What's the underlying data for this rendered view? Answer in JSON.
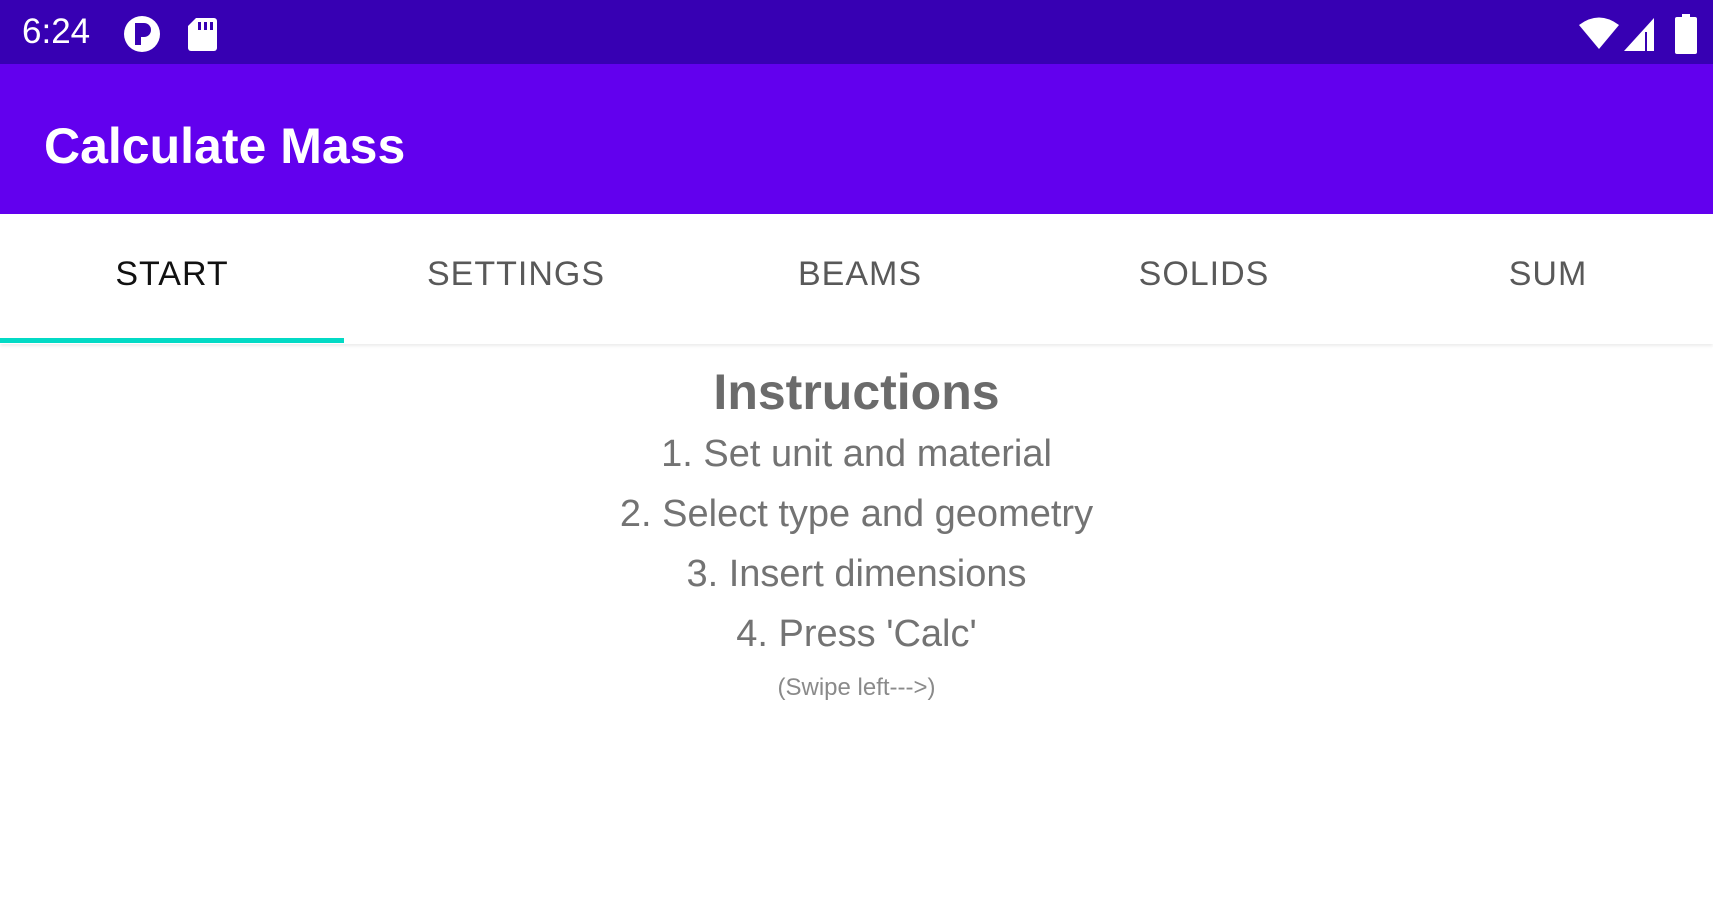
{
  "status_bar": {
    "time": "6:24",
    "left_icons": [
      "p-icon",
      "sd-card-icon"
    ],
    "right_icons": [
      "wifi-icon",
      "signal-icon",
      "battery-icon"
    ]
  },
  "app_bar": {
    "title": "Calculate Mass"
  },
  "tabs": [
    {
      "label": "START",
      "selected": true
    },
    {
      "label": "SETTINGS",
      "selected": false
    },
    {
      "label": "BEAMS",
      "selected": false
    },
    {
      "label": "SOLIDS",
      "selected": false
    },
    {
      "label": "SUM",
      "selected": false
    }
  ],
  "content": {
    "heading": "Instructions",
    "steps": [
      "1. Set unit and material",
      "2. Select type and geometry",
      "3. Insert dimensions",
      "4. Press 'Calc'"
    ],
    "hint": "(Swipe left--->)"
  },
  "colors": {
    "status_bar": "#3700b3",
    "app_bar": "#6200ee",
    "tab_indicator": "#03dac5"
  }
}
